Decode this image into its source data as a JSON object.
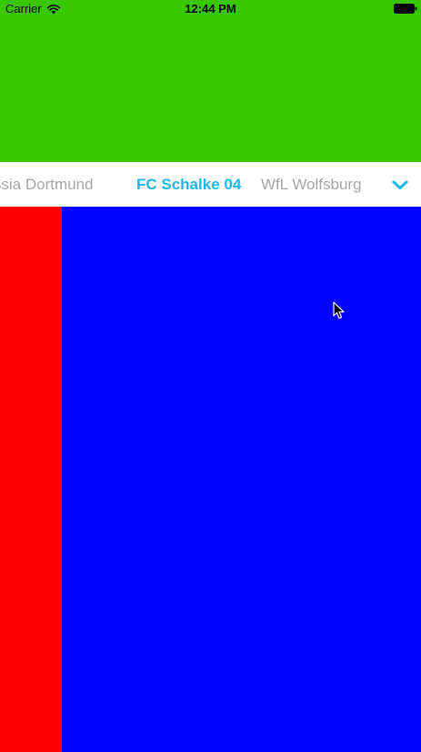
{
  "status_bar": {
    "carrier": "Carrier",
    "time": "12:44 PM",
    "icons": [
      "wifi-icon",
      "battery-icon"
    ]
  },
  "tabs": [
    {
      "label": "Borussia Dortmund",
      "selected": false
    },
    {
      "label": "FC Schalke 04",
      "selected": true
    },
    {
      "label": "WfL Wolfsburg",
      "selected": false
    }
  ],
  "menu_button": {
    "icon": "chevron-down-icon"
  },
  "colors": {
    "header": "#39c800",
    "tab_selected": "#1eb7ea",
    "tab_unselected": "#a6a6a6",
    "page_blue": "#0000ff",
    "page_red": "#ff0000"
  }
}
